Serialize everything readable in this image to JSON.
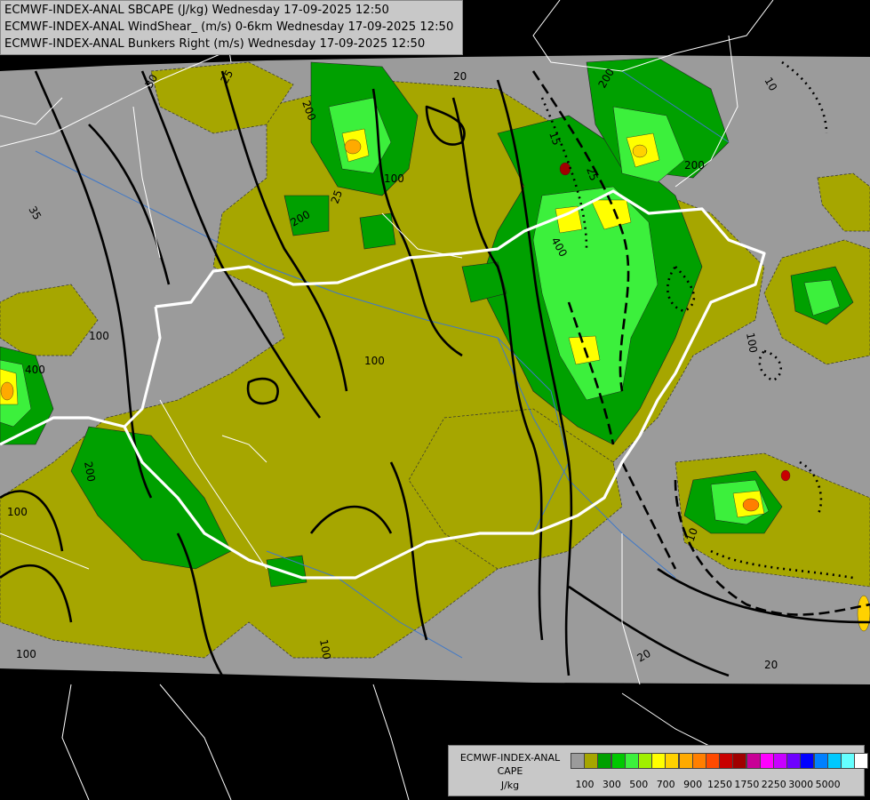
{
  "header": {
    "line1": "ECMWF-INDEX-ANAL SBCAPE (J/kg) Wednesday 17-09-2025 12:50",
    "line2": "ECMWF-INDEX-ANAL WindShear_ (m/s) 0-6km Wednesday 17-09-2025 12:50",
    "line3": "ECMWF-INDEX-ANAL Bunkers Right (m/s) Wednesday 17-09-2025 12:50"
  },
  "legend": {
    "title1": "ECMWF-INDEX-ANAL",
    "title2": "CAPE",
    "unit": "J/kg",
    "swatch_colors": [
      "#9b9b9b",
      "#a6a600",
      "#00a000",
      "#00c800",
      "#3cf03c",
      "#a0f000",
      "#ffff00",
      "#ffd200",
      "#ffaa00",
      "#ff7f00",
      "#ff4a00",
      "#c80000",
      "#a00000",
      "#c80096",
      "#ff00ff",
      "#c800ff",
      "#6e00ff",
      "#0000ff",
      "#0080ff",
      "#00c8ff",
      "#64ffff",
      "#ffffff"
    ],
    "ticks": [
      "100",
      "300",
      "500",
      "700",
      "900",
      "1250",
      "1750",
      "2250",
      "3000",
      "5000"
    ]
  },
  "contour_labels": {
    "cape": [
      "100",
      "200",
      "400"
    ],
    "shear": [
      "10",
      "15",
      "20",
      "25",
      "30",
      "35"
    ]
  },
  "colors": {
    "background": "#000000",
    "domain_gray": "#9b9b9b",
    "cape_olive": "#a6a600",
    "border": "#ffffff"
  }
}
